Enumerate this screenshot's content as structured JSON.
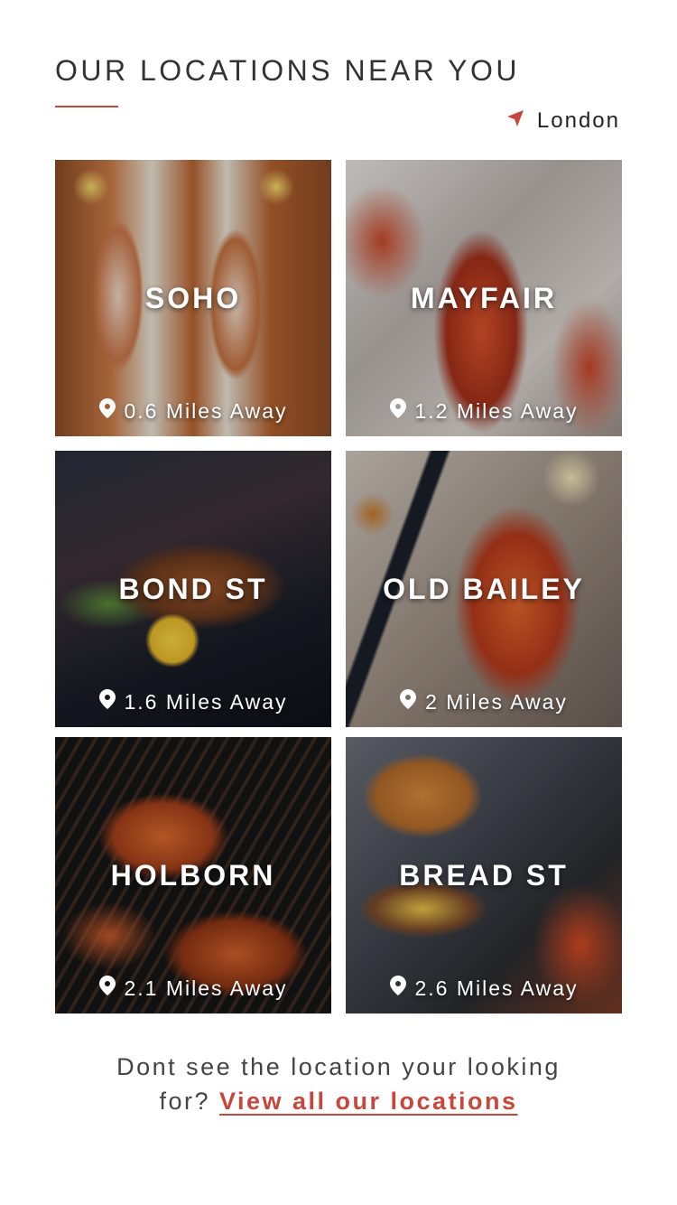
{
  "header": {
    "title": "OUR LOCATIONS NEAR YOU",
    "city": "London",
    "accent_color": "#c8473d"
  },
  "locations": [
    {
      "name": "SOHO",
      "distance": "0.6 Miles Away"
    },
    {
      "name": "MAYFAIR",
      "distance": "1.2 Miles Away"
    },
    {
      "name": "BOND ST",
      "distance": "1.6 Miles Away"
    },
    {
      "name": "OLD BAILEY",
      "distance": "2 Miles Away"
    },
    {
      "name": "HOLBORN",
      "distance": "2.1 Miles Away"
    },
    {
      "name": "BREAD ST",
      "distance": "2.6 Miles Away"
    }
  ],
  "footer": {
    "prompt_line1": "Dont see the location your looking",
    "prompt_line2": "for?",
    "link": "View all our locations"
  }
}
